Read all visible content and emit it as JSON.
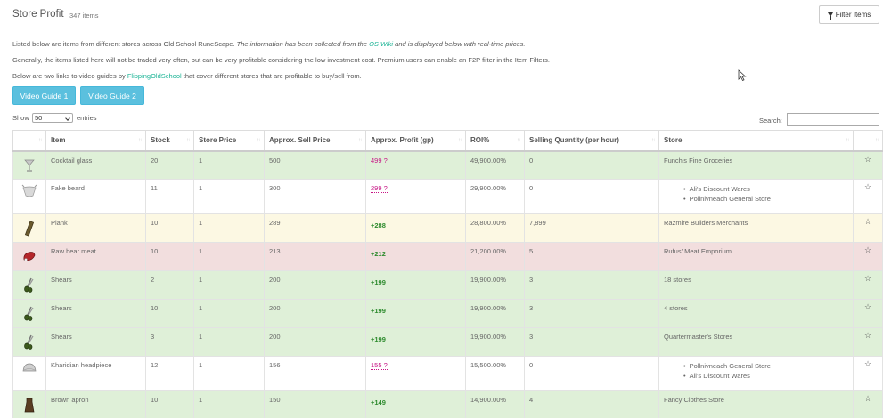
{
  "header": {
    "title": "Store Profit",
    "count": "347 items",
    "filter_label": "Filter Items"
  },
  "intro": {
    "line1_a": "Listed below are items from different stores across Old School RuneScape. ",
    "line1_b": "The information has been collected from the ",
    "line1_link": "OS Wiki",
    "line1_c": " and is displayed below with real-time prices.",
    "line2": "Generally, the items listed here will not be traded very often, but can be very profitable considering the low investment cost. Premium users can enable an F2P filter in the Item Filters.",
    "line3_a": "Below are two links to video guides by ",
    "line3_link": "FlippingOldSchool",
    "line3_b": " that cover different stores that are profitable to buy/sell from."
  },
  "guides": [
    "Video Guide 1",
    "Video Guide 2"
  ],
  "controls": {
    "show_label": "Show",
    "show_value": "50",
    "entries_label": "entries",
    "search_label": "Search:"
  },
  "table": {
    "columns": [
      "",
      "Item",
      "Stock",
      "Store Price",
      "Approx. Sell Price",
      "Approx. Profit (gp)",
      "ROI%",
      "Selling Quantity (per hour)",
      "Store",
      ""
    ],
    "rows": [
      {
        "icon": "cocktail-glass-icon",
        "item": "Cocktail glass",
        "stock": "20",
        "price": "1",
        "sell": "500",
        "profit": "499 ?",
        "profit_type": "q",
        "roi": "49,900.00%",
        "qty": "0",
        "stores": [
          "Funch's Fine Groceries"
        ],
        "list": false,
        "tint": "green"
      },
      {
        "icon": "fake-beard-icon",
        "item": "Fake beard",
        "stock": "11",
        "price": "1",
        "sell": "300",
        "profit": "299 ?",
        "profit_type": "q",
        "roi": "29,900.00%",
        "qty": "0",
        "stores": [
          "Ali's Discount Wares",
          "Pollnivneach General Store"
        ],
        "list": true,
        "tint": "white"
      },
      {
        "icon": "plank-icon",
        "item": "Plank",
        "stock": "10",
        "price": "1",
        "sell": "289",
        "profit": "+288",
        "profit_type": "pos",
        "roi": "28,800.00%",
        "qty": "7,899",
        "stores": [
          "Razmire Builders Merchants"
        ],
        "list": false,
        "tint": "yellow"
      },
      {
        "icon": "raw-bear-meat-icon",
        "item": "Raw bear meat",
        "stock": "10",
        "price": "1",
        "sell": "213",
        "profit": "+212",
        "profit_type": "pos",
        "roi": "21,200.00%",
        "qty": "5",
        "stores": [
          "Rufus' Meat Emporium"
        ],
        "list": false,
        "tint": "red"
      },
      {
        "icon": "shears-icon",
        "item": "Shears",
        "stock": "2",
        "price": "1",
        "sell": "200",
        "profit": "+199",
        "profit_type": "pos",
        "roi": "19,900.00%",
        "qty": "3",
        "stores": [
          "18 stores"
        ],
        "list": false,
        "tint": "green"
      },
      {
        "icon": "shears-icon",
        "item": "Shears",
        "stock": "10",
        "price": "1",
        "sell": "200",
        "profit": "+199",
        "profit_type": "pos",
        "roi": "19,900.00%",
        "qty": "3",
        "stores": [
          "4 stores"
        ],
        "list": false,
        "tint": "green"
      },
      {
        "icon": "shears-icon",
        "item": "Shears",
        "stock": "3",
        "price": "1",
        "sell": "200",
        "profit": "+199",
        "profit_type": "pos",
        "roi": "19,900.00%",
        "qty": "3",
        "stores": [
          "Quartermaster's Stores"
        ],
        "list": false,
        "tint": "green"
      },
      {
        "icon": "kharidian-headpiece-icon",
        "item": "Kharidian headpiece",
        "stock": "12",
        "price": "1",
        "sell": "156",
        "profit": "155 ?",
        "profit_type": "q",
        "roi": "15,500.00%",
        "qty": "0",
        "stores": [
          "Pollnivneach General Store",
          "Ali's Discount Wares"
        ],
        "list": true,
        "tint": "white"
      },
      {
        "icon": "brown-apron-icon",
        "item": "Brown apron",
        "stock": "10",
        "price": "1",
        "sell": "150",
        "profit": "+149",
        "profit_type": "pos",
        "roi": "14,900.00%",
        "qty": "4",
        "stores": [
          "Fancy Clothes Store"
        ],
        "list": false,
        "tint": "green"
      }
    ]
  }
}
